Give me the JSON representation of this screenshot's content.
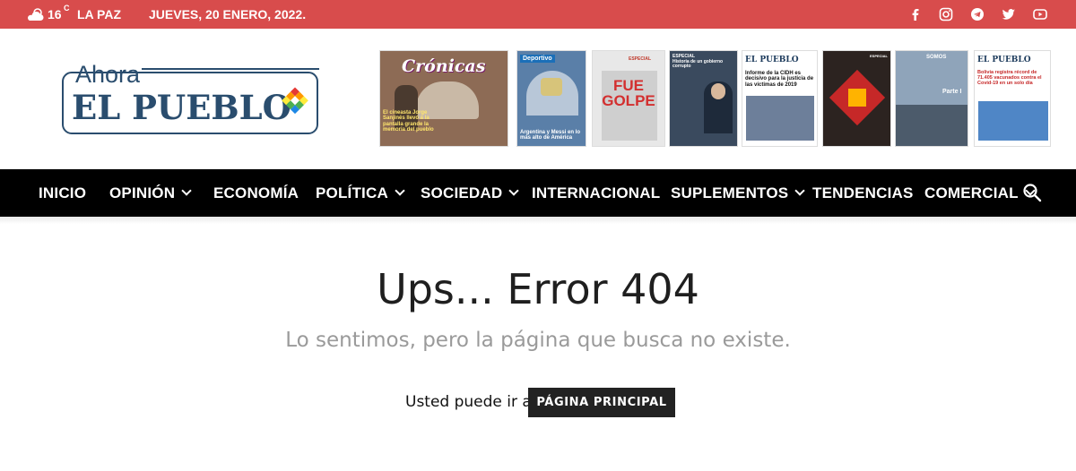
{
  "topbar": {
    "weather_icon": "cloud-sun-icon",
    "temperature": "16",
    "unit": "C",
    "city": "LA PAZ",
    "date": "JUEVES, 20 ENERO, 2022.",
    "social": [
      "facebook-icon",
      "instagram-icon",
      "telegram-icon",
      "twitter-icon",
      "youtube-icon"
    ],
    "bg_color": "#d84c4c"
  },
  "logo": {
    "top_text": "Ahora",
    "main_text": "EL PUEBLO"
  },
  "covers": [
    {
      "mast": "Crónicas",
      "headline": "El cineasta Jorge Sanjinés llevó a la pantalla grande la memoria del pueblo"
    },
    {
      "mast": "Deportivo",
      "headline": "Argentina y Messi en lo más alto de América"
    },
    {
      "mast": "ESPECIAL",
      "headline": "FUE GOLPE"
    },
    {
      "mast": "ESPECIAL",
      "headline": "Historia de un gobierno corrupto"
    },
    {
      "mast": "EL PUEBLO",
      "headline": "Informe de la CIDH es decisivo para la justicia de las víctimas de 2019"
    },
    {
      "mast": "ESPECIAL",
      "headline": ""
    },
    {
      "mast": "SOMOS",
      "headline": "Parte I"
    },
    {
      "mast": "EL PUEBLO",
      "headline": "Bolivia registra récord de 71.405 vacunados contra el Covid-19 en un solo día"
    }
  ],
  "nav": {
    "items": [
      {
        "label": "INICIO",
        "has_dropdown": false
      },
      {
        "label": "OPINIÓN",
        "has_dropdown": true
      },
      {
        "label": "ECONOMÍA",
        "has_dropdown": false
      },
      {
        "label": "POLÍTICA",
        "has_dropdown": true
      },
      {
        "label": "SOCIEDAD",
        "has_dropdown": true
      },
      {
        "label": "INTERNACIONAL",
        "has_dropdown": false
      },
      {
        "label": "SUPLEMENTOS",
        "has_dropdown": true
      },
      {
        "label": "TENDENCIAS",
        "has_dropdown": false
      },
      {
        "label": "COMERCIAL",
        "has_dropdown": true
      }
    ],
    "search_icon": "search-icon"
  },
  "error": {
    "title": "Ups... Error 404",
    "subtitle": "Lo sentimos, pero la página que busca no existe.",
    "go_text": "Usted puede ir a",
    "home_button": "PÁGINA PRINCIPAL"
  }
}
